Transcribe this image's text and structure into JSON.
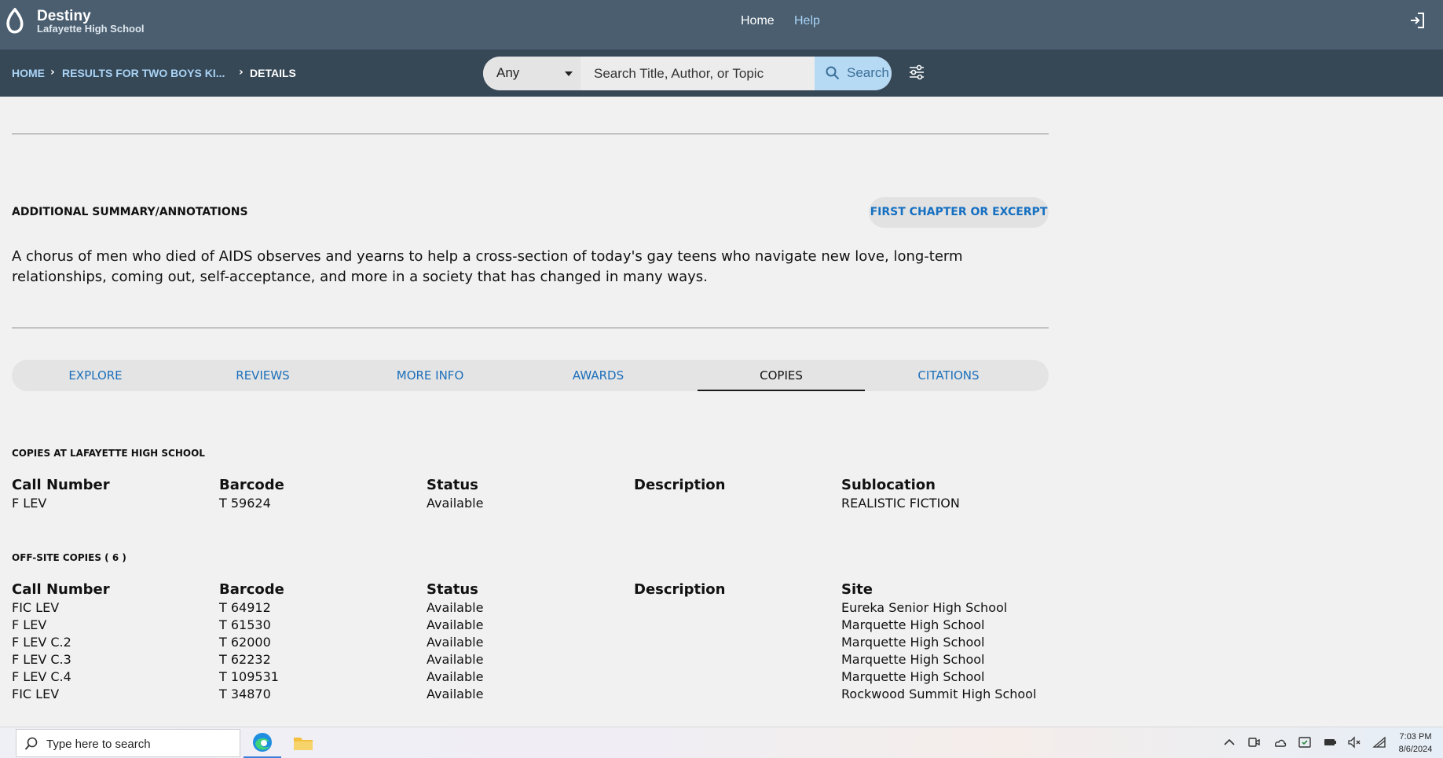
{
  "header": {
    "app_name": "Destiny",
    "school_name": "Lafayette High School",
    "nav": {
      "home": "Home",
      "help": "Help"
    },
    "login_icon": "sign-in-icon"
  },
  "breadcrumb": {
    "home": "HOME",
    "results": "RESULTS FOR TWO BOYS KI...",
    "current": "DETAILS"
  },
  "search": {
    "scope_value": "Any",
    "placeholder": "Search Title, Author, or Topic",
    "button_label": "Search"
  },
  "summary_section": {
    "title": "ADDITIONAL SUMMARY/ANNOTATIONS",
    "excerpt_button": "FIRST CHAPTER OR EXCERPT",
    "text": "A chorus of men who died of AIDS observes and yearns to help a cross-section of today's gay teens who navigate new love, long-term relationships, coming out, self-acceptance, and more in a society that has changed in many ways."
  },
  "tabs": [
    "EXPLORE",
    "REVIEWS",
    "MORE INFO",
    "AWARDS",
    "COPIES",
    "CITATIONS"
  ],
  "active_tab": "COPIES",
  "local_copies": {
    "title": "COPIES AT LAFAYETTE HIGH SCHOOL",
    "headers": [
      "Call Number",
      "Barcode",
      "Status",
      "Description",
      "Sublocation"
    ],
    "rows": [
      [
        "F LEV",
        "T 59624",
        "Available",
        "",
        "REALISTIC FICTION"
      ]
    ]
  },
  "offsite_copies": {
    "title": "OFF-SITE COPIES ( 6 )",
    "headers": [
      "Call Number",
      "Barcode",
      "Status",
      "Description",
      "Site"
    ],
    "rows": [
      [
        "FIC LEV",
        "T 64912",
        "Available",
        "",
        "Eureka Senior High School"
      ],
      [
        "F LEV",
        "T 61530",
        "Available",
        "",
        "Marquette High School"
      ],
      [
        "F LEV C.2",
        "T 62000",
        "Available",
        "",
        "Marquette High School"
      ],
      [
        "F LEV C.3",
        "T 62232",
        "Available",
        "",
        "Marquette High School"
      ],
      [
        "F LEV C.4",
        "T 109531",
        "Available",
        "",
        "Marquette High School"
      ],
      [
        "FIC LEV",
        "T 34870",
        "Available",
        "",
        "Rockwood Summit High School"
      ]
    ]
  },
  "taskbar": {
    "search_placeholder": "Type here to search",
    "time": "7:03 PM",
    "date": "8/6/2024"
  },
  "colors": {
    "header_bg": "#4a5e70",
    "subbar_bg": "#364756",
    "link_blue": "#1c6fba",
    "search_button_bg": "#b6d9f4"
  }
}
